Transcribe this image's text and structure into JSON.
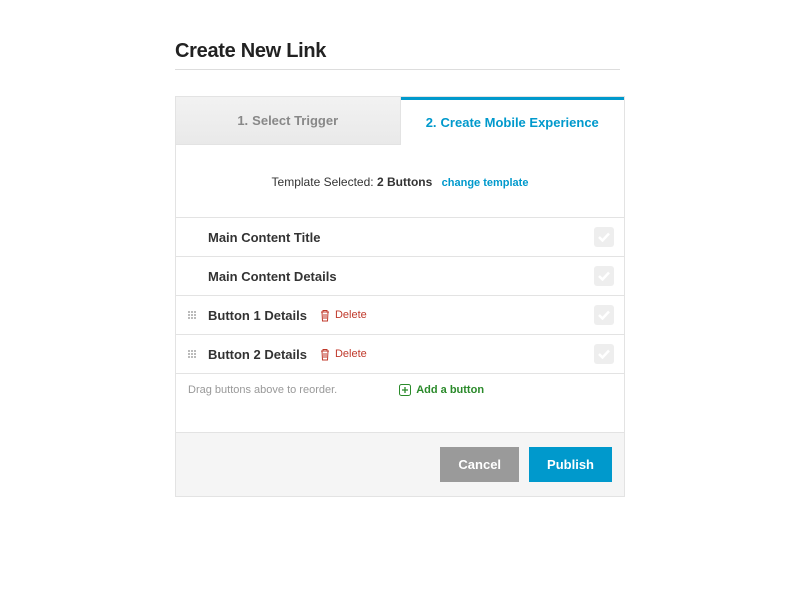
{
  "title": "Create New Link",
  "tabs": {
    "inactive": {
      "num": "1.",
      "label": "Select Trigger"
    },
    "active": {
      "num": "2.",
      "label": "Create Mobile Experience"
    }
  },
  "template": {
    "prefix": "Template Selected:",
    "name": "2 Buttons",
    "change": "change template"
  },
  "items": [
    {
      "label": "Main Content Title",
      "draggable": false,
      "delete": false
    },
    {
      "label": "Main Content Details",
      "draggable": false,
      "delete": false
    },
    {
      "label": "Button 1 Details",
      "draggable": true,
      "delete": true
    },
    {
      "label": "Button 2 Details",
      "draggable": true,
      "delete": true
    }
  ],
  "delete_label": "Delete",
  "add": {
    "hint": "Drag buttons above to reorder.",
    "label": "Add a button"
  },
  "buttons": {
    "cancel": "Cancel",
    "publish": "Publish"
  }
}
